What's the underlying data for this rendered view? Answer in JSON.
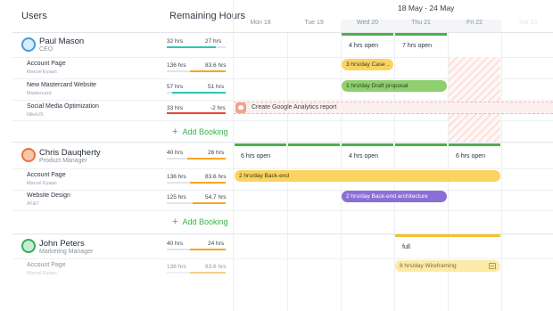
{
  "header": {
    "users_label": "Users",
    "remaining_hours_label": "Remaining Hours",
    "date_range": "18 May - 24 May",
    "days": [
      "Mon 18",
      "Tue 19",
      "Wed 20",
      "Thu 21",
      "Fri 22",
      "Sat 23"
    ]
  },
  "people": [
    {
      "name": "Paul Mason",
      "role": "CEO",
      "avatar_color": "#4a9bd6",
      "hours": {
        "allocated": "32 hrs",
        "remaining": "27 hrs",
        "fill_ratio": 0.84,
        "color": "#2ec4b6"
      },
      "projects": [
        {
          "name": "Account Page",
          "client": "Marcel Eyaan",
          "allocated": "136 hrs",
          "remaining": "83.6 hrs",
          "fill_ratio": 0.6,
          "color": "#f5a623"
        },
        {
          "name": "New Mastercard Website",
          "client": "Mastercard",
          "allocated": "57 hrs",
          "remaining": "51 hrs",
          "fill_ratio": 0.9,
          "color": "#2ec4b6"
        },
        {
          "name": "Social Media Optimization",
          "client": "NikeUS",
          "allocated": "33 hrs",
          "remaining": "-2 hrs",
          "fill_ratio": 1.0,
          "color": "#e8443a"
        }
      ],
      "add_booking": "Add Booking"
    },
    {
      "name": "Chris Dauqherty",
      "role": "Product Manager",
      "avatar_color": "#e8733a",
      "hours": {
        "allocated": "40 hrs",
        "remaining": "26 hrs",
        "fill_ratio": 0.65,
        "color": "#f5a623"
      },
      "projects": [
        {
          "name": "Account Page",
          "client": "Marcel Eyaan",
          "allocated": "136 hrs",
          "remaining": "83.6 hrs",
          "fill_ratio": 0.6,
          "color": "#f5a623"
        },
        {
          "name": "Website Design",
          "client": "AT&T",
          "allocated": "125 hrs",
          "remaining": "54.7 hrs",
          "fill_ratio": 0.55,
          "color": "#f5a623"
        }
      ],
      "add_booking": "Add Booking"
    },
    {
      "name": "John Peters",
      "role": "Marketing Manager",
      "avatar_color": "#3aaa5a",
      "hours": {
        "allocated": "40 hrs",
        "remaining": "24 hrs",
        "fill_ratio": 0.6,
        "color": "#f5a623"
      },
      "projects": [
        {
          "name": "Account Page",
          "client": "Marcel Eyaan",
          "allocated": "136 hrs",
          "remaining": "83.6 hrs",
          "fill_ratio": 0.6,
          "color": "#f5a623"
        }
      ]
    }
  ],
  "timeline": {
    "paul_capacity": [
      "4 hrs open",
      "7 hrs open"
    ],
    "paul_bookings": [
      "3 hrs/day Case ..",
      "1 hrs/day Draft proposal",
      "Create Google Analytics report"
    ],
    "chris_capacity": [
      "6 hrs open",
      "4 hrs open",
      "6 hrs open"
    ],
    "chris_bookings": [
      "2 hrs/day Back-end",
      "2 hrs/day Back-end architecture"
    ],
    "john_capacity": [
      "full"
    ],
    "john_bookings": [
      "8 hrs/day Wireframing"
    ]
  },
  "colors": {
    "green": "#4cae4c",
    "yellow": "#f5c12c",
    "purple": "#8b6fd6",
    "add_booking": "#35b54a",
    "over_budget": "#e8443a"
  }
}
